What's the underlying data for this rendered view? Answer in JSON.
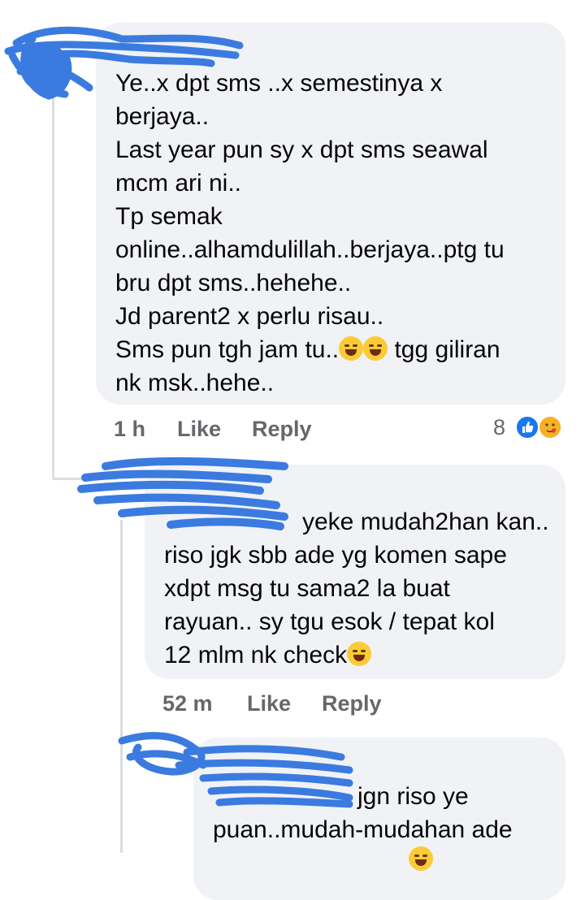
{
  "comments": [
    {
      "text_lines": [
        "Ye..x dpt sms ..x semestinya x",
        "berjaya..",
        "Last year pun sy x dpt sms seawal",
        "mcm ari ni..",
        "Tp semak",
        "online..alhamdulillah..berjaya..ptg tu",
        "bru dpt sms..hehehe..",
        "Jd parent2 x perlu risau..",
        "Sms pun tgh jam tu..",
        "nk msk..hehe.."
      ],
      "line9_tail": " tgg giliran",
      "time": "1 h",
      "like_label": "Like",
      "reply_label": "Reply",
      "reaction_count": "8",
      "reaction_icons": [
        "like-icon",
        "care-icon"
      ]
    },
    {
      "text_lines": [
        "yeke mudah2han kan..",
        "riso jgk sbb ade yg komen sape",
        "xdpt msg tu sama2 la buat",
        "rayuan.. sy tgu esok / tepat kol",
        "12 mlm nk check"
      ],
      "time": "52 m",
      "like_label": "Like",
      "reply_label": "Reply"
    },
    {
      "text_lines": [
        "jgn riso ye",
        "puan..mudah-mudahan ade"
      ]
    }
  ],
  "colors": {
    "bubble": "#f0f2f5",
    "meta_text": "#65676b",
    "redaction": "#3b7be0",
    "like_blue": "#1877f2"
  }
}
